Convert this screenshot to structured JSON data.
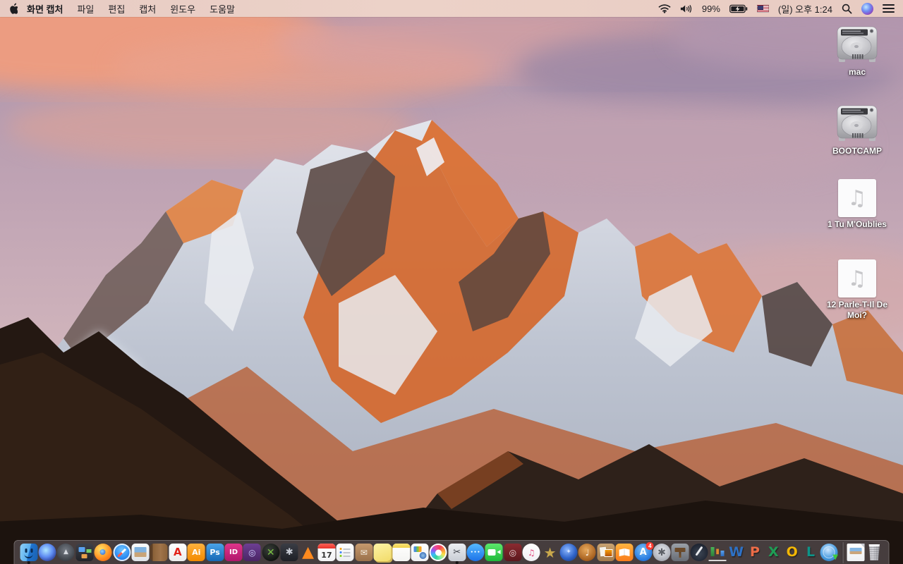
{
  "menu_bar": {
    "app_name": "화면 캡처",
    "menus": [
      "파일",
      "편집",
      "캡처",
      "윈도우",
      "도움말"
    ],
    "status": {
      "battery_percent": "99%",
      "clock": "(일) 오후 1:24",
      "icons": [
        "wifi-icon",
        "volume-icon",
        "battery-charging-icon",
        "us-flag-icon",
        "spotlight-search-icon",
        "siri-icon",
        "notification-center-icon"
      ]
    }
  },
  "desktop": {
    "icons": [
      {
        "name": "drive-mac",
        "type": "drive",
        "label": "mac"
      },
      {
        "name": "drive-bootcamp",
        "type": "drive",
        "label": "BOOTCAMP"
      },
      {
        "name": "audio-file-1",
        "type": "audio",
        "glyph": "♫",
        "label": "1 Tu M'Oublies"
      },
      {
        "name": "audio-file-2",
        "type": "audio",
        "glyph": "♫",
        "label": "12 Parle-T-Il De Moi?"
      }
    ]
  },
  "dock": {
    "icons": [
      {
        "name": "finder",
        "shape": "rsq",
        "cls": "finder",
        "bg": "linear-gradient(105deg,#8fd0f7 0%,#5ab0ef 49%,#1f74d0 51%,#1a5fae 100%)",
        "running": true
      },
      {
        "name": "siri",
        "shape": "circle",
        "bg": "radial-gradient(circle at 42% 38%,#aee6ff 0%,#5f8df2 45%,#2c3f98 80%,#171f55 100%)"
      },
      {
        "name": "launchpad",
        "shape": "circle",
        "bg": "radial-gradient(circle at 50% 40%,#767c85 0%,#3f444b 70%,#26292e 100%)",
        "glyph": "▲",
        "fg": "#d6dae0",
        "fs": 9
      },
      {
        "name": "mission-control",
        "shape": "rsq",
        "cls": "mc",
        "bg": "linear-gradient(#3d4049,#22242a)"
      },
      {
        "name": "firefox",
        "shape": "circle",
        "cls": "ffx",
        "bg": "radial-gradient(circle at 38% 32%,#ffe066 0%,#ffb13d 35%,#ff8a1e 60%,#e3570f 100%)"
      },
      {
        "name": "safari",
        "shape": "circle",
        "cls": "saf",
        "bg": "radial-gradient(circle at 50% 35%,#6fc5ff 0%,#2e8df2 55%,#1261cf 100%)"
      },
      {
        "name": "preview",
        "shape": "rsq",
        "cls": "pv",
        "bg": "linear-gradient(#fafbfc,#dfe3e8)"
      },
      {
        "name": "contacts",
        "shape": "rsq",
        "bg": "linear-gradient(90deg,#5e4026 0 4px,#8a6138 4px,#a0744a 60%,#8a6138 100%)"
      },
      {
        "name": "acrobat-reader",
        "shape": "rsq",
        "bg": "linear-gradient(#ffffff,#ececec)",
        "glyph": "A",
        "fg": "#e2231a",
        "fs": 15
      },
      {
        "name": "illustrator",
        "shape": "rsq",
        "bg": "linear-gradient(#ffb13d,#f28a00)",
        "glyph": "Ai",
        "fg": "#ffffff",
        "fs": 11
      },
      {
        "name": "photoshop",
        "shape": "rsq",
        "bg": "linear-gradient(#4aa3e8,#1668b5)",
        "glyph": "Ps",
        "fg": "#ffffff",
        "fs": 11
      },
      {
        "name": "indesign",
        "shape": "rsq",
        "bg": "linear-gradient(#e0348b,#b0176b)",
        "glyph": "ID",
        "fg": "#ffffff",
        "fs": 10
      },
      {
        "name": "toast",
        "shape": "rsq",
        "bg": "linear-gradient(#6d3f93,#4a2565)",
        "glyph": "◎",
        "fg": "#cfd4ff",
        "fs": 12
      },
      {
        "name": "green-x-app",
        "shape": "circle",
        "bg": "radial-gradient(circle at 40% 35%,#3a3f3a,#101310 75%)",
        "glyph": "✕",
        "fg": "#7ac143",
        "fs": 14
      },
      {
        "name": "disc-fan-app",
        "shape": "rsq",
        "bg": "linear-gradient(#3a3d45,#1e2026)",
        "glyph": "✱",
        "fg": "#c9cdd6",
        "fs": 13
      },
      {
        "name": "vlc",
        "shape": "plain",
        "glyph": "▲",
        "fg": "#ff8a1e",
        "fs": 22
      },
      {
        "name": "calendar",
        "shape": "rsq",
        "cls": "cal",
        "bg": "linear-gradient(#ffffff,#f2f2f4)",
        "glyph": "17",
        "fg": "#333333",
        "fs": 11
      },
      {
        "name": "reminders",
        "shape": "rsq",
        "cls": "rem",
        "bg": "linear-gradient(#ffffff,#eceef1)"
      },
      {
        "name": "archive-box-app",
        "shape": "rsq",
        "bg": "linear-gradient(#c5996d,#9a714b)",
        "glyph": "✉",
        "fg": "#f5f0e6",
        "fs": 12
      },
      {
        "name": "stickies",
        "shape": "rsq",
        "cls": "stk",
        "bg": "linear-gradient(160deg,#fdf3a6,#f2dc6a)"
      },
      {
        "name": "notes",
        "shape": "rsq",
        "cls": "note",
        "bg": "linear-gradient(#ffffff,#f4f4f2)"
      },
      {
        "name": "documents-seal-app",
        "shape": "rsq",
        "cls": "seal",
        "bg": "linear-gradient(#ffffff,#eef0f2)"
      },
      {
        "name": "photos",
        "shape": "circle",
        "cls": "ph"
      },
      {
        "name": "grab-screen-capture",
        "shape": "rsq",
        "bg": "linear-gradient(#eceef2,#c9cdd5)",
        "glyph": "✂",
        "fg": "#3c4048",
        "fs": 13,
        "running": true
      },
      {
        "name": "messages",
        "shape": "circle",
        "cls": "msg",
        "bg": "linear-gradient(#55b9ff,#1c72e8)",
        "glyph": "•••",
        "fg": "#ffffff",
        "fs": 6
      },
      {
        "name": "facetime",
        "shape": "rsq",
        "cls": "ft",
        "bg": "linear-gradient(#5ce86b,#1fb83a)"
      },
      {
        "name": "photo-booth",
        "shape": "rsq",
        "bg": "linear-gradient(#8a2a30,#5c181d)",
        "glyph": "◎",
        "fg": "#e8d9da",
        "fs": 12
      },
      {
        "name": "itunes",
        "shape": "circle",
        "bg": "linear-gradient(#ffffff,#f0f0f4)",
        "glyph": "♫",
        "fg": "#e0457b",
        "fs": 12
      },
      {
        "name": "imovie",
        "shape": "plain",
        "glyph": "★",
        "fg": "#c9a84c",
        "fs": 20
      },
      {
        "name": "idvd",
        "shape": "circle",
        "bg": "radial-gradient(circle at 42% 36%,#8db8ff 0%,#2f63c8 55%,#16336f 100%)",
        "glyph": "✦",
        "fg": "#d6e4ff",
        "fs": 9
      },
      {
        "name": "garageband",
        "shape": "circle",
        "bg": "radial-gradient(circle at 45% 35%,#e8a95c,#a55f1e 70%,#7a4312 100%)",
        "glyph": "♩",
        "fg": "#fff7ea",
        "fs": 12
      },
      {
        "name": "scrapbook-pinboard-app",
        "shape": "rsq",
        "cls": "pin",
        "bg": "linear-gradient(#c8a271,#a37c4e)"
      },
      {
        "name": "ibooks",
        "shape": "rsq",
        "cls": "bk",
        "bg": "linear-gradient(#ffb340,#f97c1a)"
      },
      {
        "name": "app-store",
        "shape": "circle",
        "bg": "radial-gradient(circle at 45% 35%,#7cc1f7,#2a7de1 65%,#1561c0 100%)",
        "glyph": "A",
        "fg": "#ffffff",
        "fs": 13,
        "badge": "4"
      },
      {
        "name": "system-preferences",
        "shape": "circle",
        "bg": "radial-gradient(circle at 50% 40%,#e8e9ee,#b9bcc4 55%,#8e9199 100%)",
        "glyph": "✱",
        "fg": "#5d6067",
        "fs": 14
      },
      {
        "name": "keynote-classic",
        "shape": "rsq",
        "cls": "kn",
        "bg": "linear-gradient(#9aa0a8,#686d75)"
      },
      {
        "name": "pages-classic",
        "shape": "circle",
        "cls": "quill",
        "bg": "radial-gradient(circle at 50% 55%,#3d4654,#1d2330 75%)"
      },
      {
        "name": "numbers-classic",
        "shape": "plain",
        "cls": "num",
        "glyph": "▮",
        "fg": "#e08a2e",
        "fs": 10
      },
      {
        "name": "ms-word",
        "shape": "plain",
        "cls": "off",
        "glyph": "W",
        "fg": "#2e71c5",
        "fs": 19
      },
      {
        "name": "ms-powerpoint",
        "shape": "plain",
        "cls": "off",
        "glyph": "P",
        "fg": "#ed6c47",
        "fs": 19
      },
      {
        "name": "ms-excel",
        "shape": "plain",
        "cls": "off",
        "glyph": "X",
        "fg": "#1f9d55",
        "fs": 19
      },
      {
        "name": "ms-outlook",
        "shape": "plain",
        "cls": "off",
        "glyph": "O",
        "fg": "#f2b705",
        "fs": 19
      },
      {
        "name": "ms-lync",
        "shape": "plain",
        "cls": "off",
        "glyph": "L",
        "fg": "#0d9488",
        "fs": 19
      },
      {
        "name": "downloader",
        "shape": "circle",
        "cls": "dl",
        "bg": "radial-gradient(circle at 45% 35%,#cfe8ff,#4a9de0 55%,#2270ae 100%)",
        "glyph": "▼",
        "fg": "#3ec93e",
        "fs": 10
      },
      {
        "separator": true
      },
      {
        "name": "document-file",
        "shape": "rsq",
        "cls": "docf"
      },
      {
        "name": "trash-full",
        "shape": "plain",
        "cls": "trashslot"
      }
    ]
  }
}
